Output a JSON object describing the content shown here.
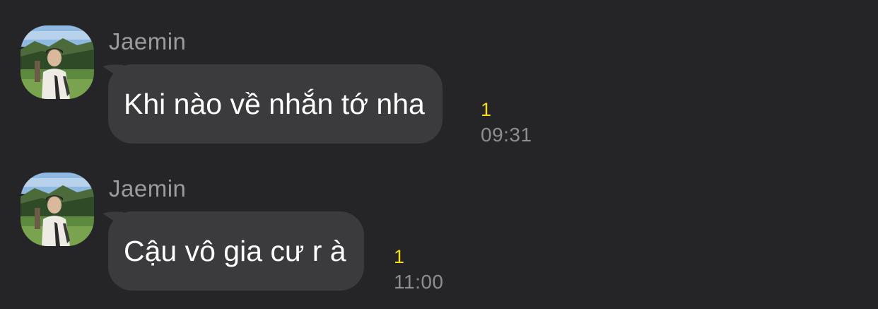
{
  "messages": [
    {
      "sender": "Jaemin",
      "text": "Khi nào về nhắn tớ nha",
      "unread_count": "1",
      "time": "09:31"
    },
    {
      "sender": "Jaemin",
      "text": "Cậu vô gia cư r à",
      "unread_count": "1",
      "time": "11:00"
    }
  ],
  "colors": {
    "background": "#252527",
    "bubble": "#3b3b3d",
    "unread": "#f3dd1b",
    "sender": "#9b9b9f",
    "time": "#8e8e92"
  },
  "icons": [
    "avatar-photo"
  ]
}
